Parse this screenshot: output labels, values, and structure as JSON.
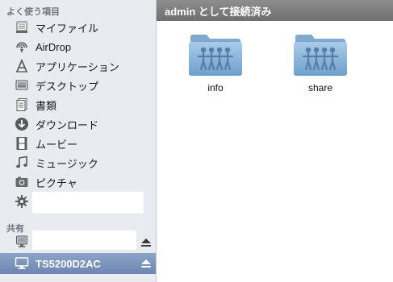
{
  "sidebar": {
    "favorites_title": "よく使う項目",
    "favorites": [
      {
        "label": "マイファイル",
        "icon": "my-files-icon"
      },
      {
        "label": "AirDrop",
        "icon": "airdrop-icon"
      },
      {
        "label": "アプリケーション",
        "icon": "applications-icon"
      },
      {
        "label": "デスクトップ",
        "icon": "desktop-icon"
      },
      {
        "label": "書類",
        "icon": "documents-icon"
      },
      {
        "label": "ダウンロード",
        "icon": "downloads-icon"
      },
      {
        "label": "ムービー",
        "icon": "movies-icon"
      },
      {
        "label": "ミュージック",
        "icon": "music-icon"
      },
      {
        "label": "ピクチャ",
        "icon": "pictures-icon"
      },
      {
        "label": "",
        "icon": "gear-icon"
      }
    ],
    "shared_title": "共有",
    "shared": [
      {
        "label": "",
        "icon": "computer-icon"
      },
      {
        "label": "TS5200D2AC",
        "icon": "display-icon",
        "selected": true
      }
    ]
  },
  "main": {
    "path_title": "admin として接続済み",
    "folders": [
      {
        "label": "info",
        "icon": "shared-folder-icon"
      },
      {
        "label": "share",
        "icon": "shared-folder-icon"
      }
    ]
  },
  "colors": {
    "sidebar_bg": "#e8ecf1",
    "selection": "#7a91bc",
    "pathbar": "#7d7d7d",
    "folder": "#8ab4d8"
  }
}
